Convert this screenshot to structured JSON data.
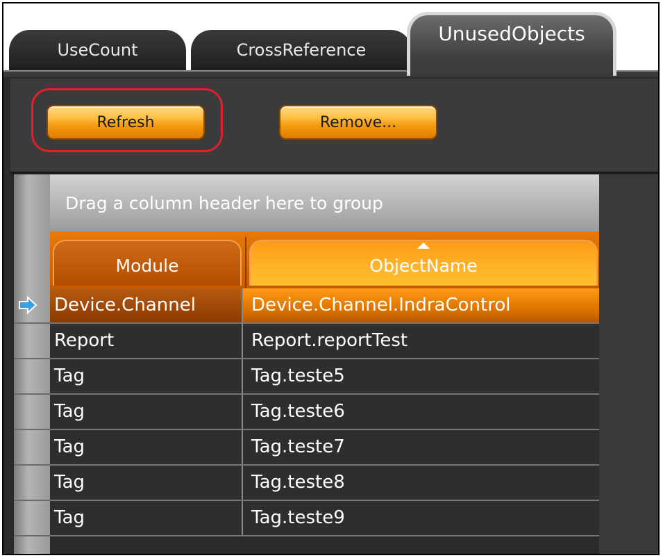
{
  "tabs": [
    {
      "label": "UseCount",
      "active": false
    },
    {
      "label": "CrossReference",
      "active": false
    },
    {
      "label": "UnusedObjects",
      "active": true
    }
  ],
  "toolbar": {
    "refresh_label": "Refresh",
    "remove_label": "Remove..."
  },
  "grid": {
    "group_panel_text": "Drag a column header here to group",
    "columns": [
      "Module",
      "ObjectName"
    ],
    "sorted_column": "ObjectName",
    "rows": [
      {
        "module": "Device.Channel",
        "object": "Device.Channel.IndraControl",
        "selected": true
      },
      {
        "module": "Report",
        "object": "Report.reportTest",
        "selected": false
      },
      {
        "module": "Tag",
        "object": "Tag.teste5",
        "selected": false
      },
      {
        "module": "Tag",
        "object": "Tag.teste6",
        "selected": false
      },
      {
        "module": "Tag",
        "object": "Tag.teste7",
        "selected": false
      },
      {
        "module": "Tag",
        "object": "Tag.teste8",
        "selected": false
      },
      {
        "module": "Tag",
        "object": "Tag.teste9",
        "selected": false
      }
    ]
  },
  "colors": {
    "accent_orange": "#f59a10",
    "highlight_red": "#e0202a",
    "row_indicator_blue": "#3aa0e8"
  }
}
